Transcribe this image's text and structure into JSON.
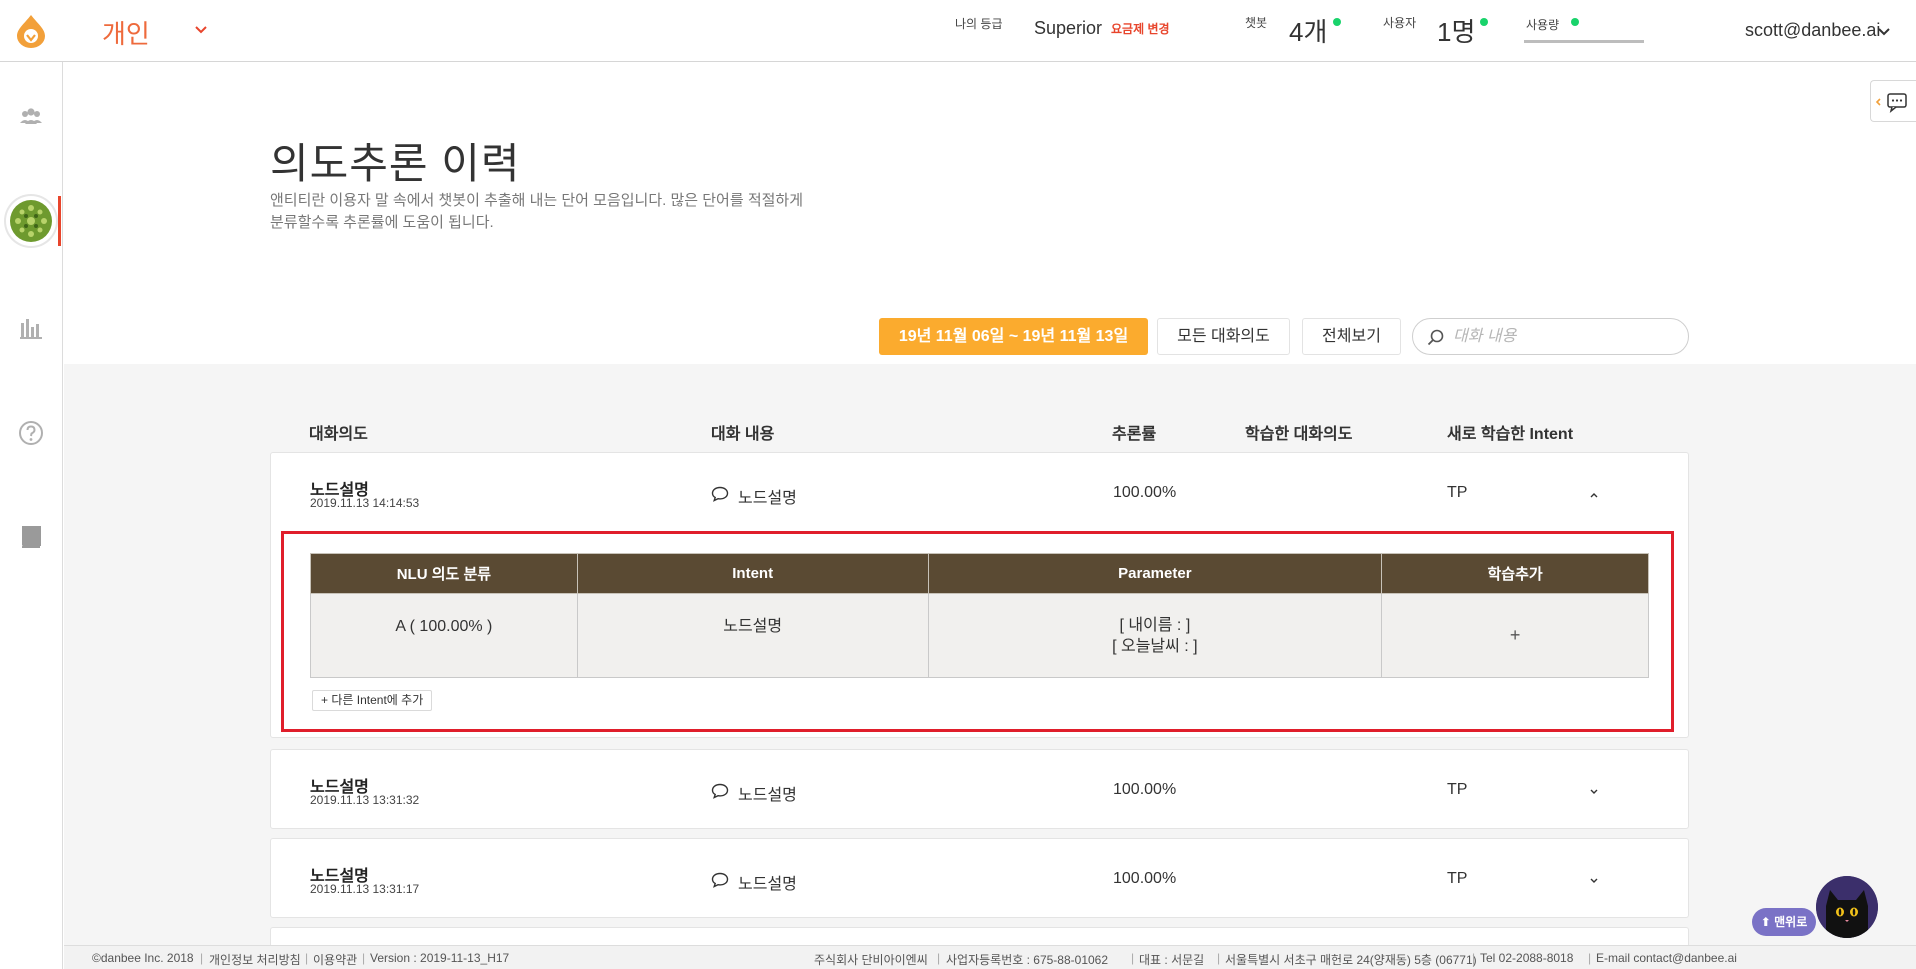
{
  "header": {
    "workspace": "개인",
    "grade_label": "나의 등급",
    "plan": "Superior",
    "plan_change": "요금제 변경",
    "chatbot_label": "챗봇",
    "chatbot_count": "4개",
    "user_label": "사용자",
    "user_count": "1명",
    "usage_label": "사용량",
    "email": "scott@danbee.ai",
    "status_color": "#19d36b"
  },
  "sidebar": {
    "items": [
      {
        "icon": "users-icon"
      },
      {
        "icon": "chatbot-avatar"
      },
      {
        "icon": "bar-chart-icon"
      },
      {
        "icon": "help-icon"
      },
      {
        "icon": "book-icon"
      }
    ],
    "active_color": "#e8452c"
  },
  "page": {
    "title": "의도추론 이력",
    "description_line1": "앤티티란 이용자 말 속에서 챗봇이 추출해 내는 단어 모음입니다. 많은 단어를 적절하게",
    "description_line2": "분류할수록 추론률에 도움이 됩니다."
  },
  "filters": {
    "date_range": "19년 11월 06일 ~ 19년 11월 13일",
    "all_intents": "모든 대화의도",
    "view_all": "전체보기",
    "search_placeholder": "대화 내용",
    "accent": "#fbab2e"
  },
  "columns": {
    "intent": "대화의도",
    "message": "대화 내용",
    "rate": "추론률",
    "learned_intent": "학습한 대화의도",
    "new_intent": "새로 학습한 Intent"
  },
  "rows": [
    {
      "intent": "노드설명",
      "date": "2019.11.13 14:14:53",
      "message": "노드설명",
      "rate": "100.00%",
      "learned": "",
      "new_intent": "TP",
      "expanded": true
    },
    {
      "intent": "노드설명",
      "date": "2019.11.13 13:31:32",
      "message": "노드설명",
      "rate": "100.00%",
      "learned": "",
      "new_intent": "TP",
      "expanded": false
    },
    {
      "intent": "노드설명",
      "date": "2019.11.13 13:31:17",
      "message": "노드설명",
      "rate": "100.00%",
      "learned": "",
      "new_intent": "TP",
      "expanded": false
    }
  ],
  "detail": {
    "headers": {
      "nlu": "NLU 의도 분류",
      "intent": "Intent",
      "parameter": "Parameter",
      "add": "학습추가"
    },
    "row": {
      "nlu": "A ( 100.00% )",
      "intent": "노드설명",
      "param1": "[ 내이름 : ]",
      "param2": "[ 오늘날씨 : ]",
      "add": "+"
    },
    "other_intent_button": "+ 다른 Intent에 추가",
    "header_color": "#5a4a33",
    "highlight_color": "#e01e2b"
  },
  "footer": {
    "copyright": "©danbee Inc. 2018",
    "privacy": "개인정보 처리방침",
    "terms": "이용약관",
    "version": "Version : 2019-11-13_H17",
    "company": "주식회사 단비아이엔씨",
    "biz_no": "사업자등록번호 : 675-88-01062",
    "ceo": "대표 : 서문길",
    "address": "서울특별시 서초구 매헌로 24(양재동) 5층 (06771)",
    "tel": "Tel 02-2088-8018",
    "email": "E-mail contact@danbee.ai"
  },
  "floating": {
    "top_button": "⬆ 맨위로"
  }
}
